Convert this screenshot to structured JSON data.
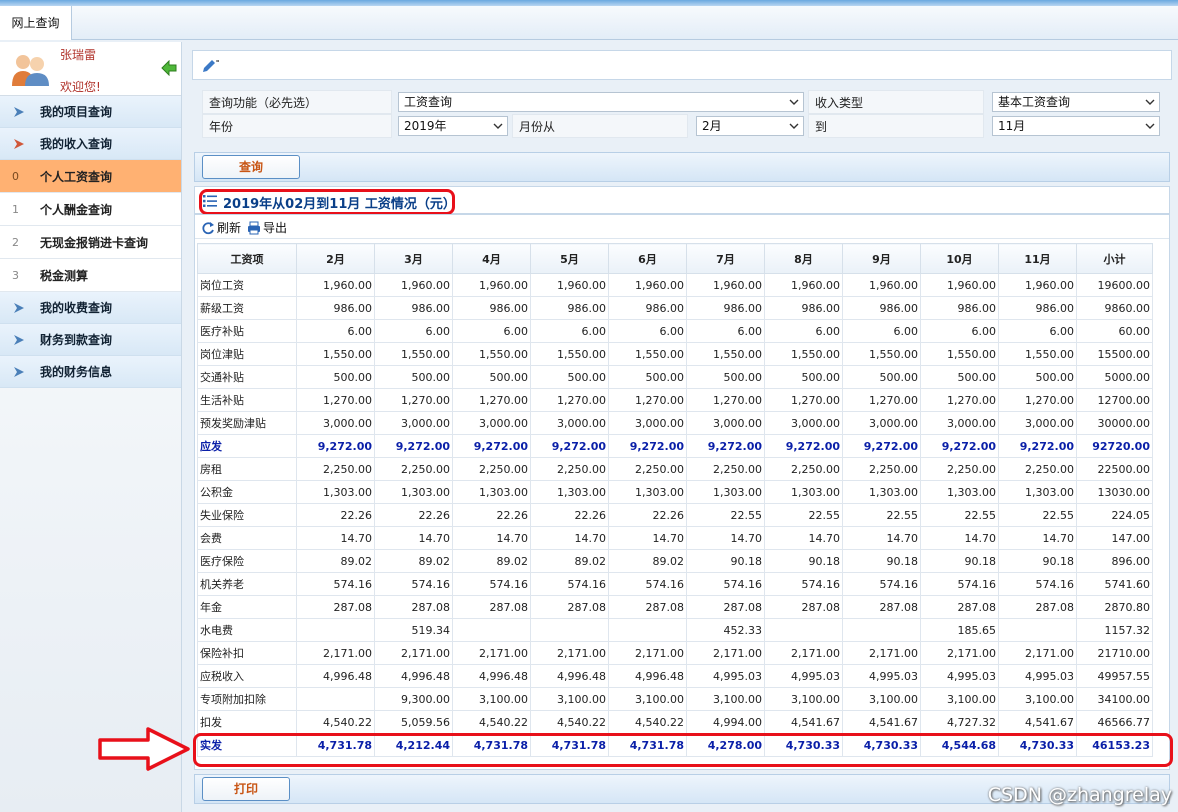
{
  "tabs": {
    "main_label": "网上查询"
  },
  "sidebar": {
    "user_name": "张瑞雷",
    "welcome": "欢迎您!",
    "nav": [
      {
        "label": "我的项目查询",
        "icon": "arrow-right-icon"
      },
      {
        "label": "我的收入查询",
        "icon": "arrow-right-icon"
      }
    ],
    "sub_items": [
      {
        "num": "0",
        "label": "个人工资查询",
        "active": true
      },
      {
        "num": "1",
        "label": "个人酬金查询"
      },
      {
        "num": "2",
        "label": "无现金报销进卡查询"
      },
      {
        "num": "3",
        "label": "税金测算"
      }
    ],
    "nav_bottom": [
      {
        "label": "我的收费查询"
      },
      {
        "label": "财务到款查询"
      },
      {
        "label": "我的财务信息"
      }
    ]
  },
  "form": {
    "func_label": "查询功能（必先选）",
    "func_value": "工资查询",
    "income_type_label": "收入类型",
    "income_type_value": "基本工资查询",
    "year_label": "年份",
    "year_value": "2019年",
    "month_from_label": "月份从",
    "month_from_value": "2月",
    "to_label": "到",
    "month_to_value": "11月",
    "query_button": "查询"
  },
  "result": {
    "title": "2019年从02月到11月 工资情况（元）",
    "refresh": "刷新",
    "export": "导出",
    "print_button": "打印"
  },
  "table": {
    "headers": [
      "工资项",
      "2月",
      "3月",
      "4月",
      "5月",
      "6月",
      "7月",
      "8月",
      "9月",
      "10月",
      "11月",
      "小计"
    ],
    "rows": [
      [
        "岗位工资",
        "1,960.00",
        "1,960.00",
        "1,960.00",
        "1,960.00",
        "1,960.00",
        "1,960.00",
        "1,960.00",
        "1,960.00",
        "1,960.00",
        "1,960.00",
        "19600.00"
      ],
      [
        "薪级工资",
        "986.00",
        "986.00",
        "986.00",
        "986.00",
        "986.00",
        "986.00",
        "986.00",
        "986.00",
        "986.00",
        "986.00",
        "9860.00"
      ],
      [
        "医疗补贴",
        "6.00",
        "6.00",
        "6.00",
        "6.00",
        "6.00",
        "6.00",
        "6.00",
        "6.00",
        "6.00",
        "6.00",
        "60.00"
      ],
      [
        "岗位津贴",
        "1,550.00",
        "1,550.00",
        "1,550.00",
        "1,550.00",
        "1,550.00",
        "1,550.00",
        "1,550.00",
        "1,550.00",
        "1,550.00",
        "1,550.00",
        "15500.00"
      ],
      [
        "交通补贴",
        "500.00",
        "500.00",
        "500.00",
        "500.00",
        "500.00",
        "500.00",
        "500.00",
        "500.00",
        "500.00",
        "500.00",
        "5000.00"
      ],
      [
        "生活补贴",
        "1,270.00",
        "1,270.00",
        "1,270.00",
        "1,270.00",
        "1,270.00",
        "1,270.00",
        "1,270.00",
        "1,270.00",
        "1,270.00",
        "1,270.00",
        "12700.00"
      ],
      [
        "预发奖励津贴",
        "3,000.00",
        "3,000.00",
        "3,000.00",
        "3,000.00",
        "3,000.00",
        "3,000.00",
        "3,000.00",
        "3,000.00",
        "3,000.00",
        "3,000.00",
        "30000.00"
      ],
      [
        "应发",
        "9,272.00",
        "9,272.00",
        "9,272.00",
        "9,272.00",
        "9,272.00",
        "9,272.00",
        "9,272.00",
        "9,272.00",
        "9,272.00",
        "9,272.00",
        "92720.00"
      ],
      [
        "房租",
        "2,250.00",
        "2,250.00",
        "2,250.00",
        "2,250.00",
        "2,250.00",
        "2,250.00",
        "2,250.00",
        "2,250.00",
        "2,250.00",
        "2,250.00",
        "22500.00"
      ],
      [
        "公积金",
        "1,303.00",
        "1,303.00",
        "1,303.00",
        "1,303.00",
        "1,303.00",
        "1,303.00",
        "1,303.00",
        "1,303.00",
        "1,303.00",
        "1,303.00",
        "13030.00"
      ],
      [
        "失业保险",
        "22.26",
        "22.26",
        "22.26",
        "22.26",
        "22.26",
        "22.55",
        "22.55",
        "22.55",
        "22.55",
        "22.55",
        "224.05"
      ],
      [
        "会费",
        "14.70",
        "14.70",
        "14.70",
        "14.70",
        "14.70",
        "14.70",
        "14.70",
        "14.70",
        "14.70",
        "14.70",
        "147.00"
      ],
      [
        "医疗保险",
        "89.02",
        "89.02",
        "89.02",
        "89.02",
        "89.02",
        "90.18",
        "90.18",
        "90.18",
        "90.18",
        "90.18",
        "896.00"
      ],
      [
        "机关养老",
        "574.16",
        "574.16",
        "574.16",
        "574.16",
        "574.16",
        "574.16",
        "574.16",
        "574.16",
        "574.16",
        "574.16",
        "5741.60"
      ],
      [
        "年金",
        "287.08",
        "287.08",
        "287.08",
        "287.08",
        "287.08",
        "287.08",
        "287.08",
        "287.08",
        "287.08",
        "287.08",
        "2870.80"
      ],
      [
        "水电费",
        "",
        "519.34",
        "",
        "",
        "",
        "452.33",
        "",
        "",
        "185.65",
        "",
        "1157.32"
      ],
      [
        "保险补扣",
        "2,171.00",
        "2,171.00",
        "2,171.00",
        "2,171.00",
        "2,171.00",
        "2,171.00",
        "2,171.00",
        "2,171.00",
        "2,171.00",
        "2,171.00",
        "21710.00"
      ],
      [
        "应税收入",
        "4,996.48",
        "4,996.48",
        "4,996.48",
        "4,996.48",
        "4,996.48",
        "4,995.03",
        "4,995.03",
        "4,995.03",
        "4,995.03",
        "4,995.03",
        "49957.55"
      ],
      [
        "专项附加扣除",
        "",
        "9,300.00",
        "3,100.00",
        "3,100.00",
        "3,100.00",
        "3,100.00",
        "3,100.00",
        "3,100.00",
        "3,100.00",
        "3,100.00",
        "34100.00"
      ],
      [
        "扣发",
        "4,540.22",
        "5,059.56",
        "4,540.22",
        "4,540.22",
        "4,540.22",
        "4,994.00",
        "4,541.67",
        "4,541.67",
        "4,727.32",
        "4,541.67",
        "46566.77"
      ],
      [
        "实发",
        "4,731.78",
        "4,212.44",
        "4,731.78",
        "4,731.78",
        "4,731.78",
        "4,278.00",
        "4,730.33",
        "4,730.33",
        "4,544.68",
        "4,730.33",
        "46153.23"
      ]
    ],
    "bold_rows": [
      7,
      20
    ]
  },
  "watermark": "CSDN @zhangrelay",
  "colors": {
    "accent": "#e8101a",
    "active_item": "#ffb172",
    "title_blue": "#0a3f88",
    "bold_row": "#0a1fa8"
  }
}
